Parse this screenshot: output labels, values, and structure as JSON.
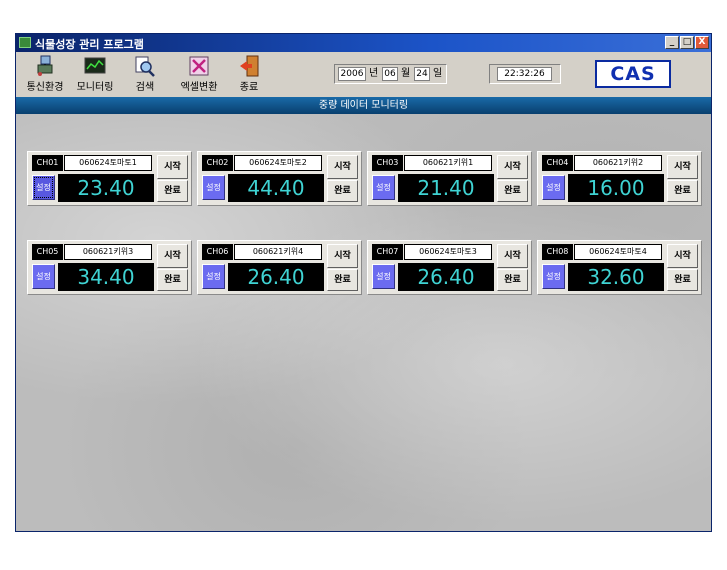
{
  "window": {
    "title": "식물성장 관리 프로그램",
    "controls": [
      "_",
      "□",
      "X"
    ]
  },
  "toolbar": {
    "items": [
      {
        "label": "통신환경",
        "icon": "network-settings-icon"
      },
      {
        "label": "모니터링",
        "icon": "monitor-icon"
      },
      {
        "label": "검색",
        "icon": "search-icon"
      },
      {
        "label": "엑셀변환",
        "icon": "excel-convert-icon"
      },
      {
        "label": "종료",
        "icon": "exit-door-icon"
      }
    ],
    "date": {
      "year": "2006",
      "year_unit": "년",
      "month": "06",
      "month_unit": "월",
      "day": "24",
      "day_unit": "일"
    },
    "time": "22:32:26",
    "logo": "CAS"
  },
  "header": {
    "title": "중량 데이터 모니터링"
  },
  "channels": [
    {
      "id": "CH01",
      "name": "060624토마토1",
      "value": "23.40",
      "set_label": "설정",
      "start_label": "시작",
      "done_label": "완료"
    },
    {
      "id": "CH02",
      "name": "060624토마토2",
      "value": "44.40",
      "set_label": "설정",
      "start_label": "시작",
      "done_label": "완료"
    },
    {
      "id": "CH03",
      "name": "060621키위1",
      "value": "21.40",
      "set_label": "설정",
      "start_label": "시작",
      "done_label": "완료"
    },
    {
      "id": "CH04",
      "name": "060621키위2",
      "value": "16.00",
      "set_label": "설정",
      "start_label": "시작",
      "done_label": "완료"
    },
    {
      "id": "CH05",
      "name": "060621키위3",
      "value": "34.40",
      "set_label": "설정",
      "start_label": "시작",
      "done_label": "완료"
    },
    {
      "id": "CH06",
      "name": "060621키위4",
      "value": "26.40",
      "set_label": "설정",
      "start_label": "시작",
      "done_label": "완료"
    },
    {
      "id": "CH07",
      "name": "060624토마토3",
      "value": "26.40",
      "set_label": "설정",
      "start_label": "시작",
      "done_label": "완료"
    },
    {
      "id": "CH08",
      "name": "060624토마토4",
      "value": "32.60",
      "set_label": "설정",
      "start_label": "시작",
      "done_label": "완료"
    }
  ],
  "colors": {
    "title_bar": "#0a246a",
    "header_bar": "#0c4f86",
    "value_text": "#3fd3d3",
    "set_button": "#6b6bf0"
  }
}
